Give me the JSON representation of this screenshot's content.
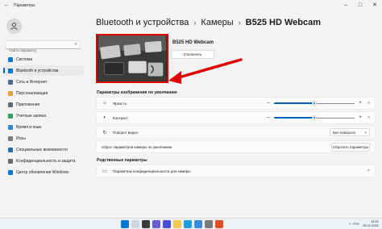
{
  "window": {
    "title": "Параметры"
  },
  "sidebar": {
    "search_placeholder": "Найти параметр",
    "items": [
      {
        "label": "Система",
        "icon": "system-icon",
        "color": "#0078d4"
      },
      {
        "label": "Bluetooth и устройства",
        "icon": "bluetooth-icon",
        "color": "#0078d4",
        "active": true
      },
      {
        "label": "Сеть и Интернет",
        "icon": "network-icon",
        "color": "#4a6b8a"
      },
      {
        "label": "Персонализация",
        "icon": "brush-icon",
        "color": "#e8a33c"
      },
      {
        "label": "Приложения",
        "icon": "apps-icon",
        "color": "#5c6b7a"
      },
      {
        "label": "Учетные записи",
        "icon": "accounts-icon",
        "color": "#2fa36b"
      },
      {
        "label": "Время и язык",
        "icon": "globe-icon",
        "color": "#2b88d8"
      },
      {
        "label": "Игры",
        "icon": "gaming-icon",
        "color": "#7a7a7a"
      },
      {
        "label": "Специальные возможности",
        "icon": "accessibility-icon",
        "color": "#1f6fb2"
      },
      {
        "label": "Конфиденциальность и защита",
        "icon": "shield-icon",
        "color": "#6b6b6b"
      },
      {
        "label": "Центр обновления Windows",
        "icon": "update-icon",
        "color": "#0078d4"
      }
    ]
  },
  "breadcrumb": {
    "items": [
      "Bluetooth и устройства",
      "Камеры",
      "B525 HD Webcam"
    ],
    "separator": "›"
  },
  "camera": {
    "name": "B525 HD Webcam",
    "disconnect_label": "Отключить"
  },
  "image_settings": {
    "title": "Параметры изображения по умолчанию",
    "brightness": {
      "label": "Яркость",
      "value": 0.5
    },
    "contrast": {
      "label": "Контраст",
      "value": 0.5
    },
    "rotation": {
      "label": "Поворот видео",
      "value": "Без поворота"
    },
    "reset": {
      "label": "Сброс параметров камеры по умолчанию",
      "button": "Сбросить параметры"
    }
  },
  "related": {
    "title": "Родственные параметры",
    "privacy_label": "Параметры конфиденциальности для камеры"
  },
  "taskbar": {
    "lang": "РУС",
    "time": "11:51",
    "date": "29.11.2021"
  },
  "colors": {
    "accent": "#005fb8",
    "highlight_border": "#e00000"
  }
}
